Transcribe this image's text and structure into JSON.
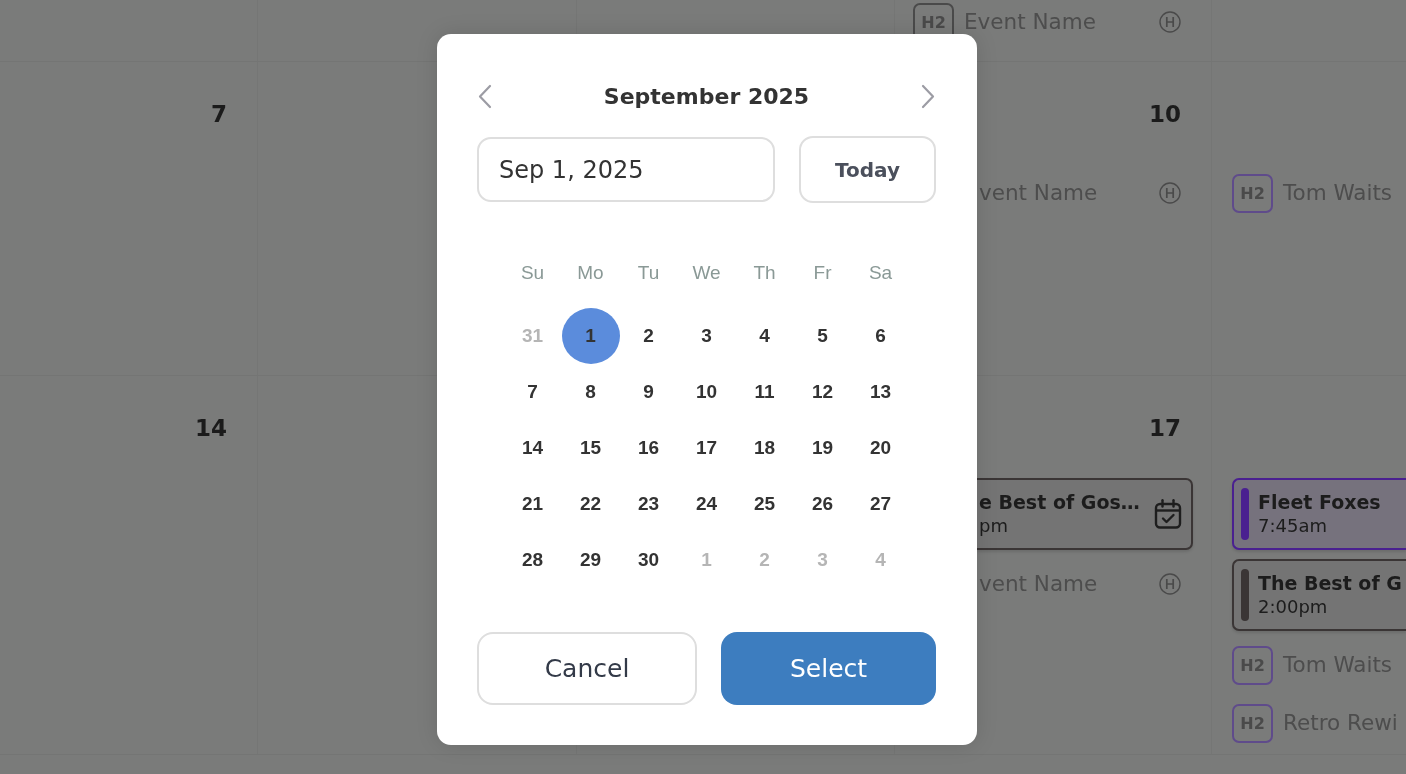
{
  "calendar": {
    "weeks": [
      {
        "column_4": {
          "events": [
            {
              "kind": "tag",
              "badge": "H2",
              "title": "Event Name",
              "color": "#4a4a4a",
              "holiday": true
            }
          ]
        }
      },
      {
        "column_1": {
          "date": "7"
        },
        "column_4": {
          "date": "10",
          "events": [
            {
              "kind": "tag",
              "title": "vent Name",
              "holiday": true
            }
          ]
        },
        "column_5": {
          "events": [
            {
              "kind": "tag",
              "badge": "H2",
              "title": "Tom Waits",
              "color": "#5f4b8b"
            }
          ]
        }
      },
      {
        "column_1": {
          "date": "14"
        },
        "column_4": {
          "date": "17",
          "events": [
            {
              "kind": "card",
              "title": "e Best of Gos…",
              "time": "pm",
              "color": "#3a3535",
              "confirmed": true
            },
            {
              "kind": "tag",
              "title": "vent Name",
              "holiday": true
            }
          ]
        },
        "column_5": {
          "events": [
            {
              "kind": "card",
              "title": "Fleet Foxes",
              "time": "7:45am",
              "color": "#4a2090"
            },
            {
              "kind": "card",
              "title": "The Best of G",
              "time": "2:00pm",
              "color": "#3a3535"
            },
            {
              "kind": "tag",
              "badge": "H2",
              "title": "Tom Waits",
              "color": "#5f4b8b"
            },
            {
              "kind": "tag",
              "badge": "H2",
              "title": "Retro Rewi",
              "color": "#5f4b8b"
            }
          ]
        }
      }
    ]
  },
  "date_picker": {
    "title": "September 2025",
    "date_input": {
      "value": "Sep 1, 2025"
    },
    "today_button": {
      "label": "Today"
    },
    "weekdays": [
      "Su",
      "Mo",
      "Tu",
      "We",
      "Th",
      "Fr",
      "Sa"
    ],
    "weeks": [
      {
        "days": [
          {
            "label": "31",
            "outside": true,
            "selected": false
          },
          {
            "label": "1",
            "outside": false,
            "selected": true
          },
          {
            "label": "2",
            "outside": false,
            "selected": false
          },
          {
            "label": "3",
            "outside": false,
            "selected": false
          },
          {
            "label": "4",
            "outside": false,
            "selected": false
          },
          {
            "label": "5",
            "outside": false,
            "selected": false
          },
          {
            "label": "6",
            "outside": false,
            "selected": false
          }
        ]
      },
      {
        "days": [
          {
            "label": "7",
            "outside": false,
            "selected": false
          },
          {
            "label": "8",
            "outside": false,
            "selected": false
          },
          {
            "label": "9",
            "outside": false,
            "selected": false
          },
          {
            "label": "10",
            "outside": false,
            "selected": false
          },
          {
            "label": "11",
            "outside": false,
            "selected": false
          },
          {
            "label": "12",
            "outside": false,
            "selected": false
          },
          {
            "label": "13",
            "outside": false,
            "selected": false
          }
        ]
      },
      {
        "days": [
          {
            "label": "14",
            "outside": false,
            "selected": false
          },
          {
            "label": "15",
            "outside": false,
            "selected": false
          },
          {
            "label": "16",
            "outside": false,
            "selected": false
          },
          {
            "label": "17",
            "outside": false,
            "selected": false
          },
          {
            "label": "18",
            "outside": false,
            "selected": false
          },
          {
            "label": "19",
            "outside": false,
            "selected": false
          },
          {
            "label": "20",
            "outside": false,
            "selected": false
          }
        ]
      },
      {
        "days": [
          {
            "label": "21",
            "outside": false,
            "selected": false
          },
          {
            "label": "22",
            "outside": false,
            "selected": false
          },
          {
            "label": "23",
            "outside": false,
            "selected": false
          },
          {
            "label": "24",
            "outside": false,
            "selected": false
          },
          {
            "label": "25",
            "outside": false,
            "selected": false
          },
          {
            "label": "26",
            "outside": false,
            "selected": false
          },
          {
            "label": "27",
            "outside": false,
            "selected": false
          }
        ]
      },
      {
        "days": [
          {
            "label": "28",
            "outside": false,
            "selected": false
          },
          {
            "label": "29",
            "outside": false,
            "selected": false
          },
          {
            "label": "30",
            "outside": false,
            "selected": false
          },
          {
            "label": "1",
            "outside": true,
            "selected": false
          },
          {
            "label": "2",
            "outside": true,
            "selected": false
          },
          {
            "label": "3",
            "outside": true,
            "selected": false
          },
          {
            "label": "4",
            "outside": true,
            "selected": false
          }
        ]
      }
    ],
    "buttons": [
      {
        "label": "Cancel",
        "kind": "secondary"
      },
      {
        "label": "Select",
        "kind": "primary"
      }
    ]
  }
}
